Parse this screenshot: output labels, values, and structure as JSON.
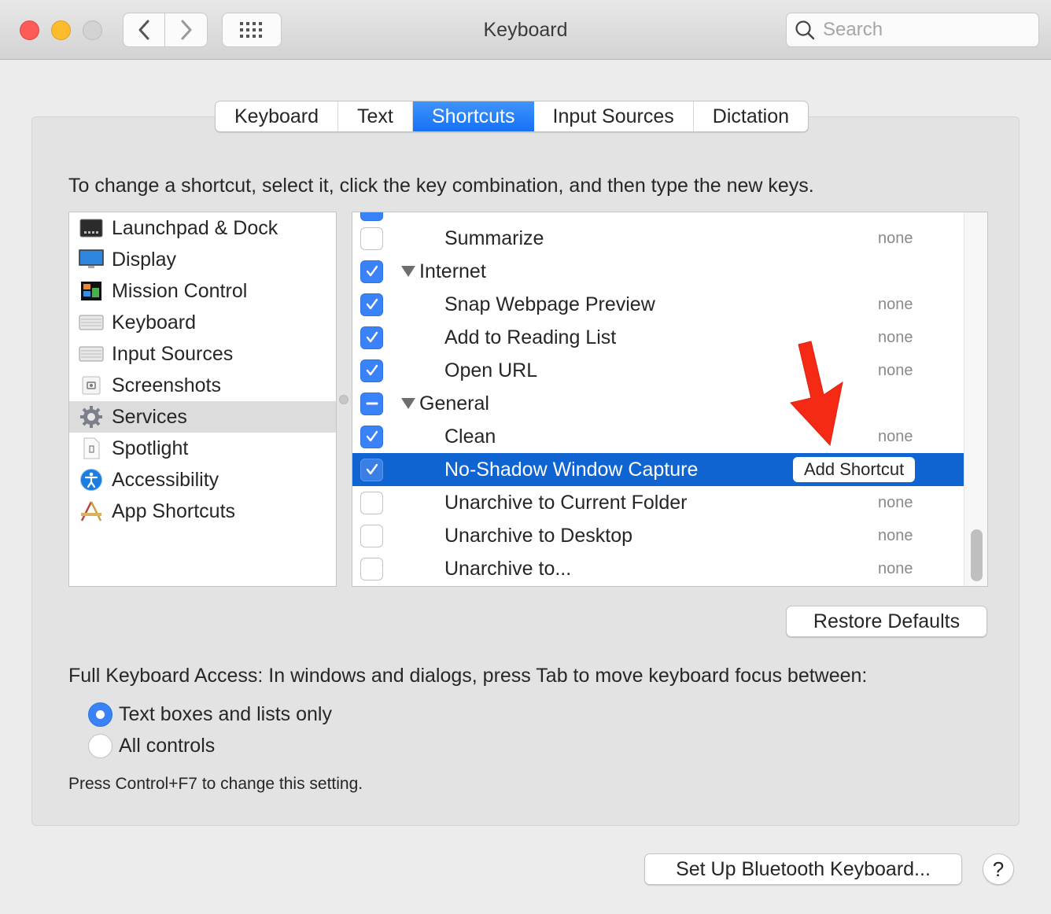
{
  "window": {
    "title": "Keyboard",
    "search_placeholder": "Search"
  },
  "tabs": [
    {
      "label": "Keyboard",
      "active": false
    },
    {
      "label": "Text",
      "active": false
    },
    {
      "label": "Shortcuts",
      "active": true
    },
    {
      "label": "Input Sources",
      "active": false
    },
    {
      "label": "Dictation",
      "active": false
    }
  ],
  "instructions": "To change a shortcut, select it, click the key combination, and then type the new keys.",
  "categories": [
    {
      "label": "Launchpad & Dock",
      "icon": "launchpad-dock-icon"
    },
    {
      "label": "Display",
      "icon": "display-icon"
    },
    {
      "label": "Mission Control",
      "icon": "mission-control-icon"
    },
    {
      "label": "Keyboard",
      "icon": "keyboard-icon"
    },
    {
      "label": "Input Sources",
      "icon": "input-sources-icon"
    },
    {
      "label": "Screenshots",
      "icon": "screenshots-icon"
    },
    {
      "label": "Services",
      "icon": "gear-icon",
      "selected": true
    },
    {
      "label": "Spotlight",
      "icon": "spotlight-icon"
    },
    {
      "label": "Accessibility",
      "icon": "accessibility-icon"
    },
    {
      "label": "App Shortcuts",
      "icon": "app-shortcuts-icon"
    }
  ],
  "shortcuts": [
    {
      "name": "Summarize",
      "type": "item",
      "state": "off",
      "key": "none"
    },
    {
      "name": "Internet",
      "type": "group",
      "state": "on",
      "key": ""
    },
    {
      "name": "Snap Webpage Preview",
      "type": "item",
      "state": "on",
      "key": "none"
    },
    {
      "name": "Add to Reading List",
      "type": "item",
      "state": "on",
      "key": "none"
    },
    {
      "name": "Open URL",
      "type": "item",
      "state": "on",
      "key": "none"
    },
    {
      "name": "General",
      "type": "group",
      "state": "mixed",
      "key": ""
    },
    {
      "name": "Clean",
      "type": "item",
      "state": "on",
      "key": "none"
    },
    {
      "name": "No-Shadow Window Capture",
      "type": "item",
      "state": "on",
      "key": "",
      "selected": true,
      "action_label": "Add Shortcut"
    },
    {
      "name": "Unarchive to Current Folder",
      "type": "item",
      "state": "off",
      "key": "none"
    },
    {
      "name": "Unarchive to Desktop",
      "type": "item",
      "state": "off",
      "key": "none"
    },
    {
      "name": "Unarchive to...",
      "type": "item",
      "state": "off",
      "key": "none"
    }
  ],
  "buttons": {
    "restore_defaults": "Restore Defaults",
    "bluetooth": "Set Up Bluetooth Keyboard...",
    "help": "?"
  },
  "full_keyboard_access": {
    "label": "Full Keyboard Access: In windows and dialogs, press Tab to move keyboard focus between:",
    "options": [
      {
        "label": "Text boxes and lists only",
        "selected": true
      },
      {
        "label": "All controls",
        "selected": false
      }
    ],
    "hint": "Press Control+F7 to change this setting."
  },
  "colors": {
    "accent": "#1672f5",
    "selection": "#0f64d2",
    "annotation_arrow": "#f52a14"
  }
}
